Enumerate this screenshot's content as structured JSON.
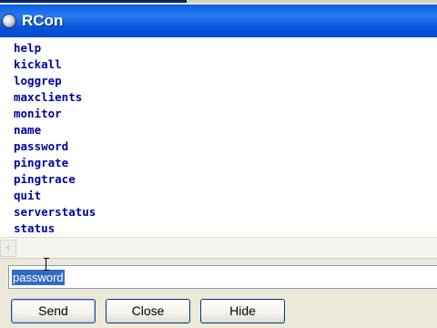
{
  "window": {
    "title": "RCon",
    "icon": "rcon-app-icon"
  },
  "output": {
    "lines": [
      "help",
      "kickall",
      "loggrep",
      "maxclients",
      "monitor",
      "name",
      "password",
      "pingrate",
      "pingtrace",
      "quit",
      "serverstatus",
      "status"
    ]
  },
  "scrollbar": {
    "left_arrow": "‹"
  },
  "command": {
    "value": "password"
  },
  "buttons": {
    "send": "Send",
    "close": "Close",
    "hide": "Hide"
  },
  "colors": {
    "title_bar": "#0a5ee8",
    "output_text": "#0000a0",
    "selection": "#316ac5"
  }
}
